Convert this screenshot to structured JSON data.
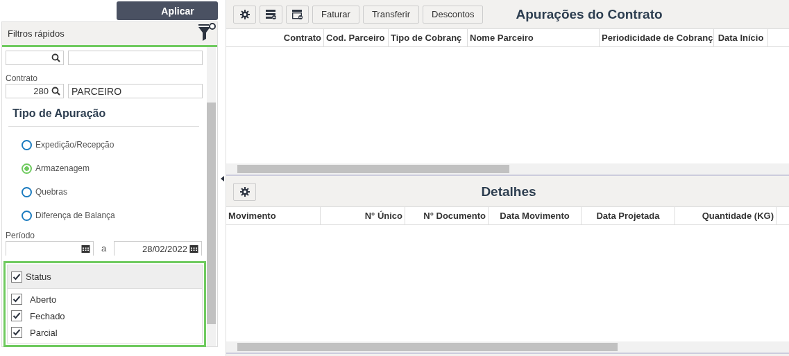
{
  "apply_button": "Aplicar",
  "filters": {
    "title": "Filtros rápidos",
    "fields": [
      {
        "kind": "lookup"
      },
      {
        "kind": "lookup",
        "label": "Contrato",
        "value": "280",
        "description": "PARCEIRO"
      }
    ],
    "section_title": "Tipo de Apuração",
    "options": [
      {
        "label": "Expedição/Recepção",
        "selected": false
      },
      {
        "label": "Armazenagem",
        "selected": true
      },
      {
        "label": "Quebras",
        "selected": false
      },
      {
        "label": "Diferença de Balança",
        "selected": false
      }
    ],
    "period": {
      "label": "Período",
      "separator": "a",
      "to": "28/02/2022"
    },
    "status": {
      "label": "Status",
      "checked": true,
      "items": [
        {
          "label": "Aberto",
          "checked": true
        },
        {
          "label": "Fechado",
          "checked": true
        },
        {
          "label": "Parcial",
          "checked": true
        }
      ]
    }
  },
  "contracts": {
    "title": "Apurações do Contrato",
    "toolbar": [
      {
        "kind": "gear"
      },
      {
        "kind": "card-minus"
      },
      {
        "kind": "card-dash"
      },
      {
        "kind": "text",
        "label": "Faturar"
      },
      {
        "kind": "text",
        "label": "Transferir"
      },
      {
        "kind": "text",
        "label": "Descontos"
      }
    ],
    "columns": [
      "Contrato",
      "Cod. Parceiro",
      "Tipo de Cobranç",
      "Nome Parceiro",
      "Periodicidade de Cobranç",
      "Data Início"
    ]
  },
  "details": {
    "title": "Detalhes",
    "toolbar": [
      {
        "kind": "gear"
      }
    ],
    "columns": [
      "Movimento",
      "N° Único",
      "N° Documento",
      "Data Movimento",
      "Data Projetada",
      "Quantidade (KG)"
    ]
  }
}
